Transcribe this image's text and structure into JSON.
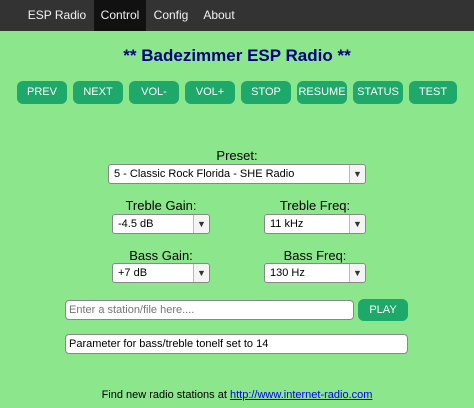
{
  "nav": {
    "items": [
      {
        "label": "ESP Radio"
      },
      {
        "label": "Control"
      },
      {
        "label": "Config"
      },
      {
        "label": "About"
      }
    ],
    "active_index": 1
  },
  "title": "** Badezimmer ESP Radio **",
  "buttons": {
    "prev": "PREV",
    "next": "NEXT",
    "vol_down": "VOL-",
    "vol_up": "VOL+",
    "stop": "STOP",
    "resume": "RESUME",
    "status": "STATUS",
    "test": "TEST"
  },
  "preset": {
    "label": "Preset:",
    "value": "5 - Classic Rock Florida - SHE Radio"
  },
  "treble_gain": {
    "label": "Treble Gain:",
    "value": "-4.5 dB"
  },
  "treble_freq": {
    "label": "Treble Freq:",
    "value": "11 kHz"
  },
  "bass_gain": {
    "label": "Bass Gain:",
    "value": "+7 dB"
  },
  "bass_freq": {
    "label": "Bass Freq:",
    "value": "130 Hz"
  },
  "station_input": {
    "placeholder": "Enter a station/file here....",
    "value": ""
  },
  "play_label": "PLAY",
  "status_text": "Parameter for bass/treble tonelf set to 14",
  "footer": {
    "text": "Find new radio stations at ",
    "link_text": "http://www.internet-radio.com"
  },
  "colors": {
    "background": "#8ce68c",
    "nav_bg": "#333333",
    "nav_active": "#111111",
    "button_bg": "#1ea86a",
    "title": "#000080"
  }
}
